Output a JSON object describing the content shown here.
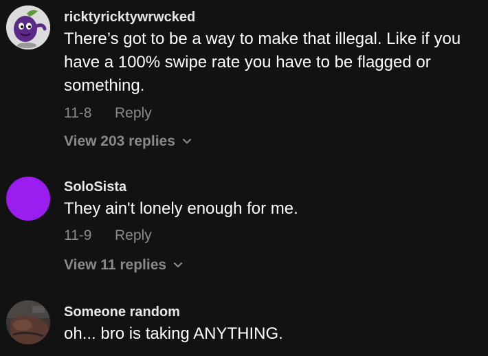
{
  "comments": [
    {
      "username": "ricktyricktywrwcked",
      "text": "There’s got to be a way to make that illegal. Like if you have a 100% swipe rate you have to be flagged or something.",
      "date": "11-8",
      "reply_label": "Reply",
      "view_replies": "View 203 replies",
      "avatar_icon": "grape-character-icon"
    },
    {
      "username": "SoloSista",
      "text": "They ain't lonely enough for me.",
      "date": "11-9",
      "reply_label": "Reply",
      "view_replies": "View 11 replies",
      "avatar_color": "#9b1df0"
    },
    {
      "username": "Someone random",
      "text": "oh... bro is taking ANYTHING.",
      "avatar_icon": "photo-avatar-icon"
    }
  ],
  "colors": {
    "background": "#121212",
    "meta_text": "#8a8a8a",
    "purple_avatar": "#9b1df0"
  }
}
